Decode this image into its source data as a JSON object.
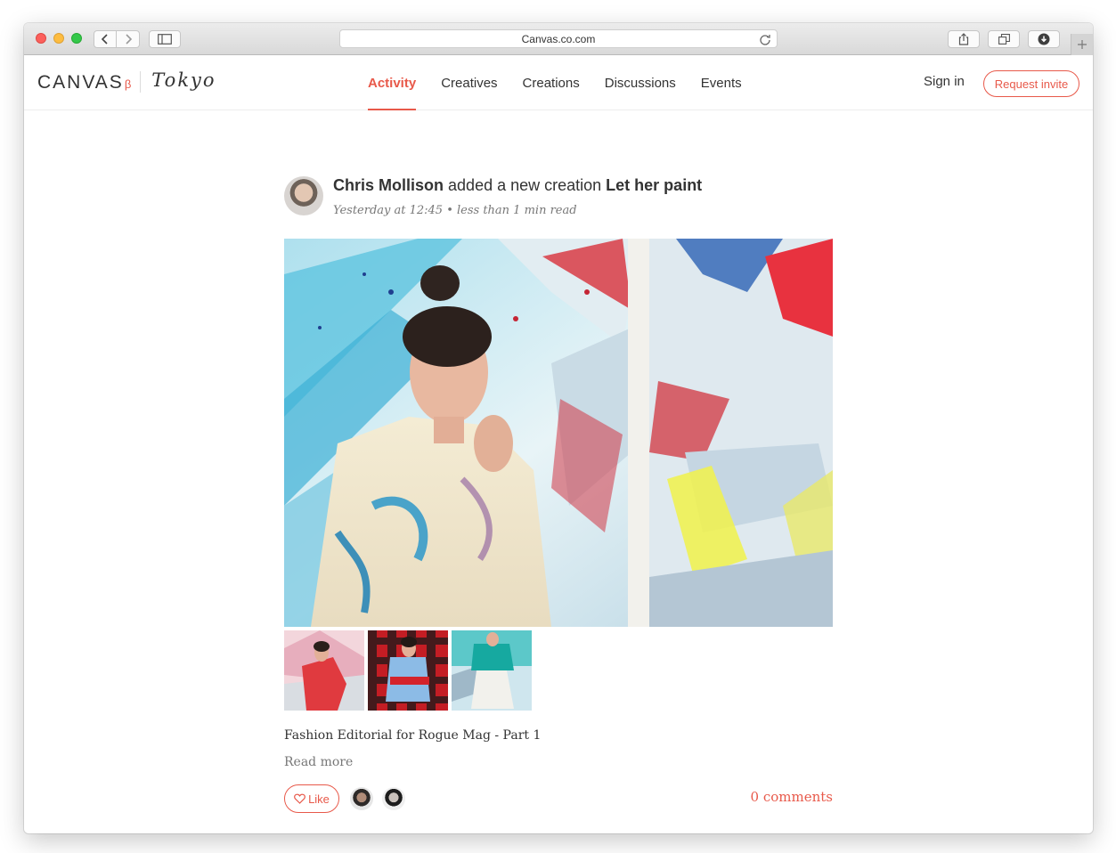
{
  "browser": {
    "url": "Canvas.co.com"
  },
  "site": {
    "logo": "CANVAS",
    "beta": "β",
    "city": "Tokyo",
    "nav": [
      {
        "label": "Activity",
        "active": true
      },
      {
        "label": "Creatives",
        "active": false
      },
      {
        "label": "Creations",
        "active": false
      },
      {
        "label": "Discussions",
        "active": false
      },
      {
        "label": "Events",
        "active": false
      }
    ],
    "sign_in": "Sign in",
    "request_invite": "Request invite",
    "accent_color": "#e8594a"
  },
  "post": {
    "author": "Chris Mollison",
    "action": "added a new creation",
    "creation_title": "Let her paint",
    "meta": "Yesterday at 12:45 • less than 1 min read",
    "caption": "Fashion Editorial for Rogue Mag - Part 1",
    "read_more": "Read more",
    "like_label": "Like",
    "comments": "0 comments",
    "thumbnails": [
      "photo-red-kimono",
      "photo-red-plaid",
      "photo-teal-top"
    ],
    "liker_avatars": [
      "avatar-liker-1",
      "avatar-liker-2"
    ]
  }
}
